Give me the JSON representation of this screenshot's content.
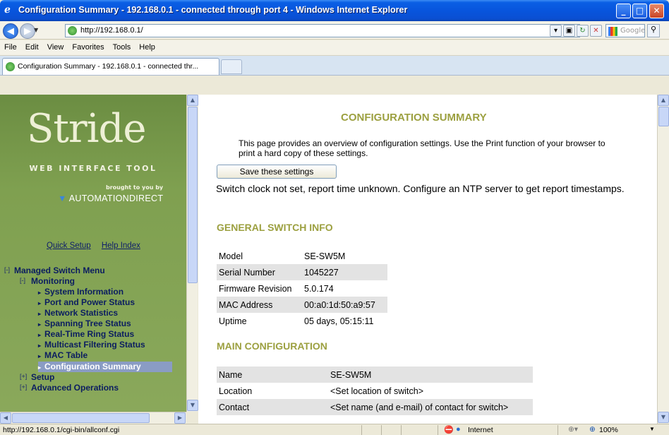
{
  "window": {
    "title": "Configuration Summary - 192.168.0.1 - connected through port 4 - Windows Internet Explorer"
  },
  "address_bar": {
    "url": "http://192.168.0.1/",
    "search_placeholder": "Google"
  },
  "menubar": [
    "File",
    "Edit",
    "View",
    "Favorites",
    "Tools",
    "Help"
  ],
  "tab": {
    "label": "Configuration Summary - 192.168.0.1 - connected thr..."
  },
  "left": {
    "logo": "Stride",
    "tagline": "WEB INTERFACE TOOL",
    "brought_by": "brought to you by",
    "company": "AUTOMATIONDIRECT",
    "quick_links": [
      "Quick Setup",
      "Help Index"
    ],
    "menu": [
      {
        "toggle": "[-]",
        "label": "Managed Switch Menu",
        "level": 0
      },
      {
        "toggle": "[-]",
        "label": "Monitoring",
        "level": 1
      },
      {
        "label": "System Information",
        "level": 2
      },
      {
        "label": "Port and Power Status",
        "level": 2
      },
      {
        "label": "Network Statistics",
        "level": 2
      },
      {
        "label": "Spanning Tree Status",
        "level": 2
      },
      {
        "label": "Real-Time Ring Status",
        "level": 2
      },
      {
        "label": "Multicast Filtering Status",
        "level": 2
      },
      {
        "label": "MAC Table",
        "level": 2
      },
      {
        "label": "Configuration Summary",
        "level": 2,
        "selected": true
      },
      {
        "toggle": "[+]",
        "label": "Setup",
        "level": 1
      },
      {
        "toggle": "[+]",
        "label": "Advanced Operations",
        "level": 1
      }
    ]
  },
  "main": {
    "heading": "CONFIGURATION SUMMARY",
    "intro": "This page provides an overview of configuration settings. Use the Print function of your browser to print a hard copy of these settings.",
    "save_button": "Save these settings",
    "notice": "Switch clock not set, report time unknown. Configure an NTP server to get report timestamps.",
    "general_heading": "GENERAL SWITCH INFO",
    "general": [
      {
        "key": "Model",
        "value": "SE-SW5M"
      },
      {
        "key": "Serial Number",
        "value": "1045227"
      },
      {
        "key": "Firmware Revision",
        "value": "5.0.174"
      },
      {
        "key": "MAC Address",
        "value": "00:a0:1d:50:a9:57"
      },
      {
        "key": "Uptime",
        "value": "05 days, 05:15:11"
      }
    ],
    "main_heading": "MAIN CONFIGURATION",
    "mainconf": [
      {
        "key": "Name",
        "value": "SE-SW5M"
      },
      {
        "key": "Location",
        "value": "<Set location of switch>"
      },
      {
        "key": "Contact",
        "value": "<Set name (and e-mail) of contact for switch>"
      }
    ]
  },
  "status": {
    "text": "http://192.168.0.1/cgi-bin/allconf.cgi",
    "zone": "Internet",
    "zoom": "100%"
  },
  "colors": {
    "heading": "#9ca040",
    "left_panel": "#7fa050",
    "menu_text": "#0b1d60",
    "selected_bg": "#8a9cc4"
  }
}
